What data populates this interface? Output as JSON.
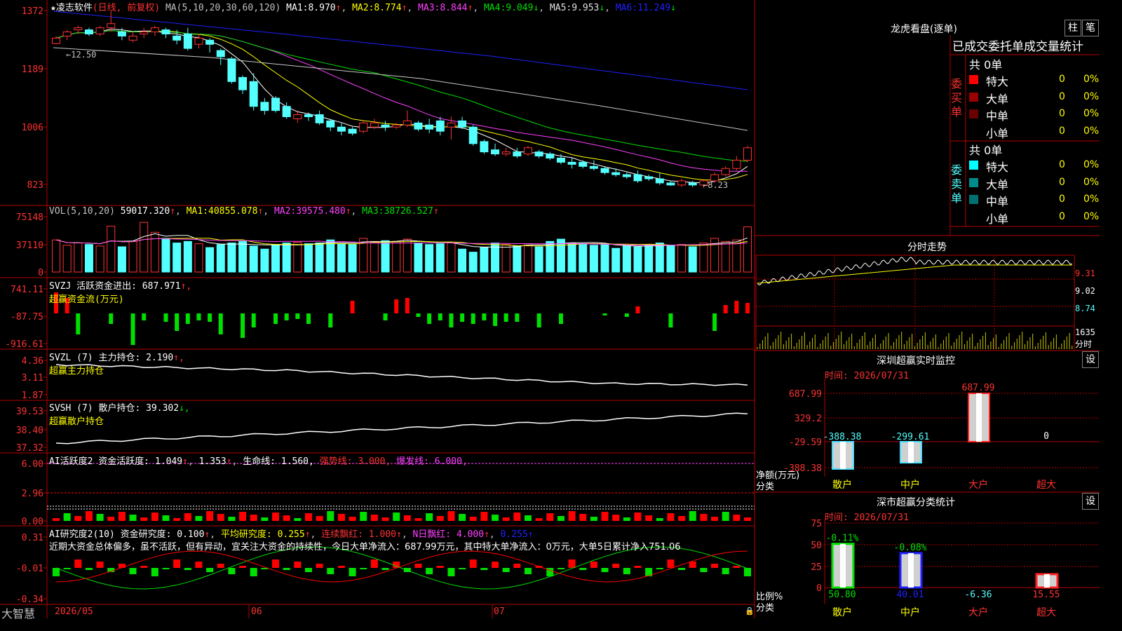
{
  "app": {
    "brand": "大智慧"
  },
  "colors": {
    "up": "#ff3232",
    "down": "#54ffff",
    "grid": "#b40000",
    "ma1": "#ffffff",
    "ma2": "#ffff00",
    "ma3": "#ff40ff",
    "ma4": "#00e000",
    "ma5": "#c8c8c8",
    "ma6": "#2020ff"
  },
  "kline": {
    "title": "★凌志软件",
    "period": "(日线, 前复权)",
    "ma_label": "MA(5,10,20,30,60,120)",
    "ma": [
      {
        "name": "MA1:",
        "value": "8.970",
        "arrow": "↑"
      },
      {
        "name": "MA2:",
        "value": "8.774",
        "arrow": "↑"
      },
      {
        "name": "MA3:",
        "value": "8.844",
        "arrow": "↑"
      },
      {
        "name": "MA4:",
        "value": "9.049",
        "arrow": "↓"
      },
      {
        "name": "MA5:",
        "value": "9.953",
        "arrow": "↓"
      },
      {
        "name": "MA6:",
        "value": "11.249",
        "arrow": "↓"
      }
    ],
    "y_ticks": [
      "1372",
      "1189",
      "1006",
      "823"
    ],
    "high_note": "←12.50",
    "low_note": "←8.23"
  },
  "vol": {
    "label": "VOL(5,10,20)",
    "value": "59017.320",
    "arrow": "↑",
    "ma": [
      {
        "name": "MA1:",
        "value": "40855.078",
        "arrow": "↑"
      },
      {
        "name": "MA2:",
        "value": "39575.480",
        "arrow": "↑"
      },
      {
        "name": "MA3:",
        "value": "38726.527",
        "arrow": "↑"
      }
    ],
    "y_ticks": [
      "75148",
      "37110",
      "0"
    ]
  },
  "svzj": {
    "label": "SVZJ  活跃资金进出:",
    "value": "687.971",
    "arrow": "↑,",
    "sub": "超赢资金流(万元)",
    "y_ticks": [
      "741.11",
      "-87.75",
      "-916.61"
    ]
  },
  "svzl": {
    "label": "SVZL (7) 主力持仓:",
    "value": "2.190",
    "arrow": "↑,",
    "sub": "超赢主力持仓",
    "y_ticks": [
      "4.36",
      "3.11",
      "1.87"
    ]
  },
  "svsh": {
    "label": "SVSH (7) 散户持仓:",
    "value": "39.302",
    "arrow": "↓,",
    "sub": "超赢散户持仓",
    "y_ticks": [
      "39.53",
      "38.40",
      "37.32"
    ]
  },
  "ai_active": {
    "label": "AI活跃度2 资金活跃度:",
    "v1": "1.049",
    "v2": "1.353",
    "life": "生命线:",
    "life_v": "1.560,",
    "strong": "强势线:",
    "strong_v": "3.000,",
    "burst": "爆发线:",
    "burst_v": "6.000,",
    "y_ticks": [
      "6.00",
      "2.96",
      "0.00"
    ]
  },
  "ai_research": {
    "label": "AI研究度2(10) 资金研究度:",
    "v1": "0.100",
    "avg": "平均研究度:",
    "avg_v": "0.255",
    "cont": "连续飘红:",
    "cont_v": "1.000",
    "nday": "N日飘红:",
    "nday_v": "4.000",
    "last": "0.255",
    "y_ticks": [
      "0.31",
      "-0.01",
      "-0.34"
    ],
    "comment": "近期大资金总体偏多，虽不活跃，但有异动，宜关注大资金的持续性，今日大单净流入：687.99万元，其中特大单净流入：0万元，大单5日累计净入751.06"
  },
  "dates": [
    "2026/05",
    "06",
    "07"
  ],
  "dragon": {
    "title": "龙虎看盘(逐单)",
    "btn1": "柱",
    "btn2": "笔",
    "tabs": [
      "已成交",
      "委托单",
      "成交量统计"
    ],
    "buy": {
      "side": "委买单",
      "total": "共 0单",
      "rows": [
        {
          "label": "特大",
          "count": "0",
          "pct": "0%",
          "color": "#ff0000"
        },
        {
          "label": "大单",
          "count": "0",
          "pct": "0%",
          "color": "#9a0000"
        },
        {
          "label": "中单",
          "count": "0",
          "pct": "0%",
          "color": "#6a0000"
        },
        {
          "label": "小单",
          "count": "0",
          "pct": "0%",
          "color": "#000000"
        }
      ]
    },
    "sell": {
      "side": "委卖单",
      "total": "共 0单",
      "rows": [
        {
          "label": "特大",
          "count": "0",
          "pct": "0%",
          "color": "#00ffff"
        },
        {
          "label": "大单",
          "count": "0",
          "pct": "0%",
          "color": "#008c8c"
        },
        {
          "label": "中单",
          "count": "0",
          "pct": "0%",
          "color": "#007070"
        },
        {
          "label": "小单",
          "count": "0",
          "pct": "0%",
          "color": "#000000"
        }
      ]
    }
  },
  "intraday": {
    "title": "分时走势",
    "y_ticks": [
      "9.31",
      "9.02",
      "8.74"
    ],
    "vol_tick": "1635",
    "vol_unit": "分时"
  },
  "monitor": {
    "title": "深圳超赢实时监控",
    "btn": "设",
    "time": "时间: 2026/07/31",
    "unit": "净额(万元)",
    "cat_label": "分类",
    "y_ticks": [
      "687.99",
      "329.2",
      "-29.59",
      "-388.38"
    ],
    "chart_data": {
      "type": "bar",
      "categories": [
        "散户",
        "中户",
        "大户",
        "超大"
      ],
      "values": [
        -388.38,
        -299.61,
        687.99,
        0
      ],
      "labels": [
        "-388.38",
        "-299.61",
        "687.99",
        "0"
      ],
      "ylabel": "净额(万元)",
      "ylim": [
        -388.38,
        687.99
      ]
    }
  },
  "classify": {
    "title": "深市超赢分类统计",
    "btn": "设",
    "time": "时间: 2026/07/31",
    "unit": "比例%",
    "cat_label": "分类",
    "y_ticks": [
      "75",
      "50",
      "25",
      "0"
    ],
    "chart_data": {
      "type": "bar",
      "categories": [
        "散户",
        "中户",
        "大户",
        "超大"
      ],
      "values": [
        50.8,
        40.01,
        -6.36,
        15.55
      ],
      "labels": [
        "50.80",
        "40.01",
        "-6.36",
        "15.55"
      ],
      "changes": [
        "-0.11%",
        "-0.08%",
        "",
        ""
      ],
      "ylabel": "比例%",
      "ylim": [
        0,
        75
      ]
    }
  },
  "chart_data": {
    "type": "candlestick",
    "title": "凌志软件 (日线, 前复权)",
    "x_ticks": [
      "2026/05",
      "06",
      "07"
    ],
    "ohlc": [
      [
        11.72,
        11.85,
        11.7,
        11.9
      ],
      [
        11.9,
        12.0,
        11.8,
        12.05
      ],
      [
        12.05,
        12.1,
        11.95,
        12.15
      ],
      [
        12.05,
        11.95,
        11.9,
        12.1
      ],
      [
        11.95,
        12.1,
        11.9,
        12.15
      ],
      [
        12.1,
        12.2,
        12.0,
        12.5
      ],
      [
        12.0,
        11.9,
        11.8,
        12.1
      ],
      [
        11.8,
        11.9,
        11.75,
        12.0
      ],
      [
        11.95,
        12.0,
        11.85,
        12.1
      ],
      [
        12.0,
        12.1,
        11.9,
        12.15
      ],
      [
        12.05,
        11.95,
        11.85,
        12.1
      ],
      [
        11.9,
        11.8,
        11.7,
        12.05
      ],
      [
        11.95,
        11.6,
        11.55,
        12.1
      ],
      [
        11.7,
        11.85,
        11.6,
        11.95
      ],
      [
        11.8,
        11.7,
        11.5,
        11.85
      ],
      [
        11.55,
        11.4,
        11.2,
        11.6
      ],
      [
        11.35,
        10.8,
        10.75,
        11.4
      ],
      [
        10.9,
        10.6,
        10.5,
        10.95
      ],
      [
        10.8,
        10.2,
        10.1,
        11.0
      ],
      [
        10.3,
        10.1,
        10.0,
        10.4
      ],
      [
        10.4,
        10.1,
        10.05,
        10.45
      ],
      [
        10.2,
        9.95,
        9.9,
        10.3
      ],
      [
        9.9,
        10.0,
        9.8,
        10.1
      ],
      [
        10.0,
        9.95,
        9.85,
        10.05
      ],
      [
        10.0,
        9.8,
        9.75,
        10.1
      ],
      [
        9.85,
        9.7,
        9.6,
        9.9
      ],
      [
        9.7,
        9.6,
        9.5,
        9.8
      ],
      [
        9.65,
        9.55,
        9.5,
        9.7
      ],
      [
        9.6,
        9.8,
        9.55,
        9.85
      ],
      [
        9.7,
        9.8,
        9.65,
        9.9
      ],
      [
        9.75,
        9.7,
        9.6,
        9.85
      ],
      [
        9.7,
        9.75,
        9.65,
        9.8
      ],
      [
        9.75,
        9.85,
        9.7,
        10.1
      ],
      [
        9.8,
        9.65,
        9.6,
        9.85
      ],
      [
        9.75,
        9.65,
        9.55,
        9.9
      ],
      [
        9.85,
        9.6,
        9.5,
        9.95
      ],
      [
        9.7,
        9.8,
        9.4,
        9.95
      ],
      [
        9.85,
        9.7,
        9.65,
        9.95
      ],
      [
        9.7,
        9.3,
        9.25,
        9.75
      ],
      [
        9.35,
        9.1,
        9.05,
        9.4
      ],
      [
        9.15,
        9.05,
        9.0,
        9.3
      ],
      [
        9.05,
        9.1,
        9.0,
        9.2
      ],
      [
        9.1,
        9.0,
        8.95,
        9.2
      ],
      [
        9.05,
        9.2,
        9.0,
        9.25
      ],
      [
        9.1,
        9.0,
        8.95,
        9.15
      ],
      [
        9.05,
        8.95,
        8.9,
        9.1
      ],
      [
        8.95,
        8.85,
        8.8,
        9.05
      ],
      [
        8.85,
        8.8,
        8.7,
        8.95
      ],
      [
        8.85,
        8.75,
        8.7,
        8.9
      ],
      [
        8.75,
        8.7,
        8.65,
        8.9
      ],
      [
        8.7,
        8.6,
        8.55,
        8.75
      ],
      [
        8.6,
        8.55,
        8.5,
        8.7
      ],
      [
        8.55,
        8.5,
        8.45,
        8.6
      ],
      [
        8.55,
        8.4,
        8.35,
        8.65
      ],
      [
        8.5,
        8.45,
        8.4,
        8.55
      ],
      [
        8.45,
        8.35,
        8.3,
        8.6
      ],
      [
        8.35,
        8.3,
        8.28,
        8.4
      ],
      [
        8.3,
        8.4,
        8.25,
        8.45
      ],
      [
        8.35,
        8.3,
        8.25,
        8.4
      ],
      [
        8.3,
        8.4,
        8.23,
        8.45
      ],
      [
        8.4,
        8.55,
        8.35,
        8.6
      ],
      [
        8.55,
        8.7,
        8.5,
        8.75
      ],
      [
        8.7,
        8.9,
        8.65,
        9.0
      ],
      [
        8.9,
        9.2,
        8.85,
        9.25
      ]
    ],
    "ylim": [
      8.23,
      12.5
    ],
    "volume": [
      42000,
      35000,
      38000,
      36000,
      34000,
      60000,
      33000,
      40000,
      65000,
      52000,
      44000,
      38000,
      40000,
      37000,
      32000,
      36000,
      38000,
      40000,
      34000,
      30000,
      36000,
      38000,
      39000,
      37000,
      38000,
      42000,
      37000,
      36000,
      44000,
      40000,
      41000,
      40000,
      43000,
      38000,
      36000,
      37000,
      38000,
      30000,
      26000,
      32000,
      38000,
      36000,
      34000,
      37000,
      33000,
      40000,
      43000,
      38000,
      37000,
      35000,
      36000,
      31000,
      34000,
      33000,
      36000,
      38000,
      35000,
      36000,
      33000,
      38000,
      44000,
      40000,
      42000,
      59017
    ],
    "volume_ma": [
      {
        "name": "MA1",
        "value": 40855.078
      },
      {
        "name": "MA2",
        "value": 39575.48
      },
      {
        "name": "MA3",
        "value": 38726.527
      }
    ]
  }
}
